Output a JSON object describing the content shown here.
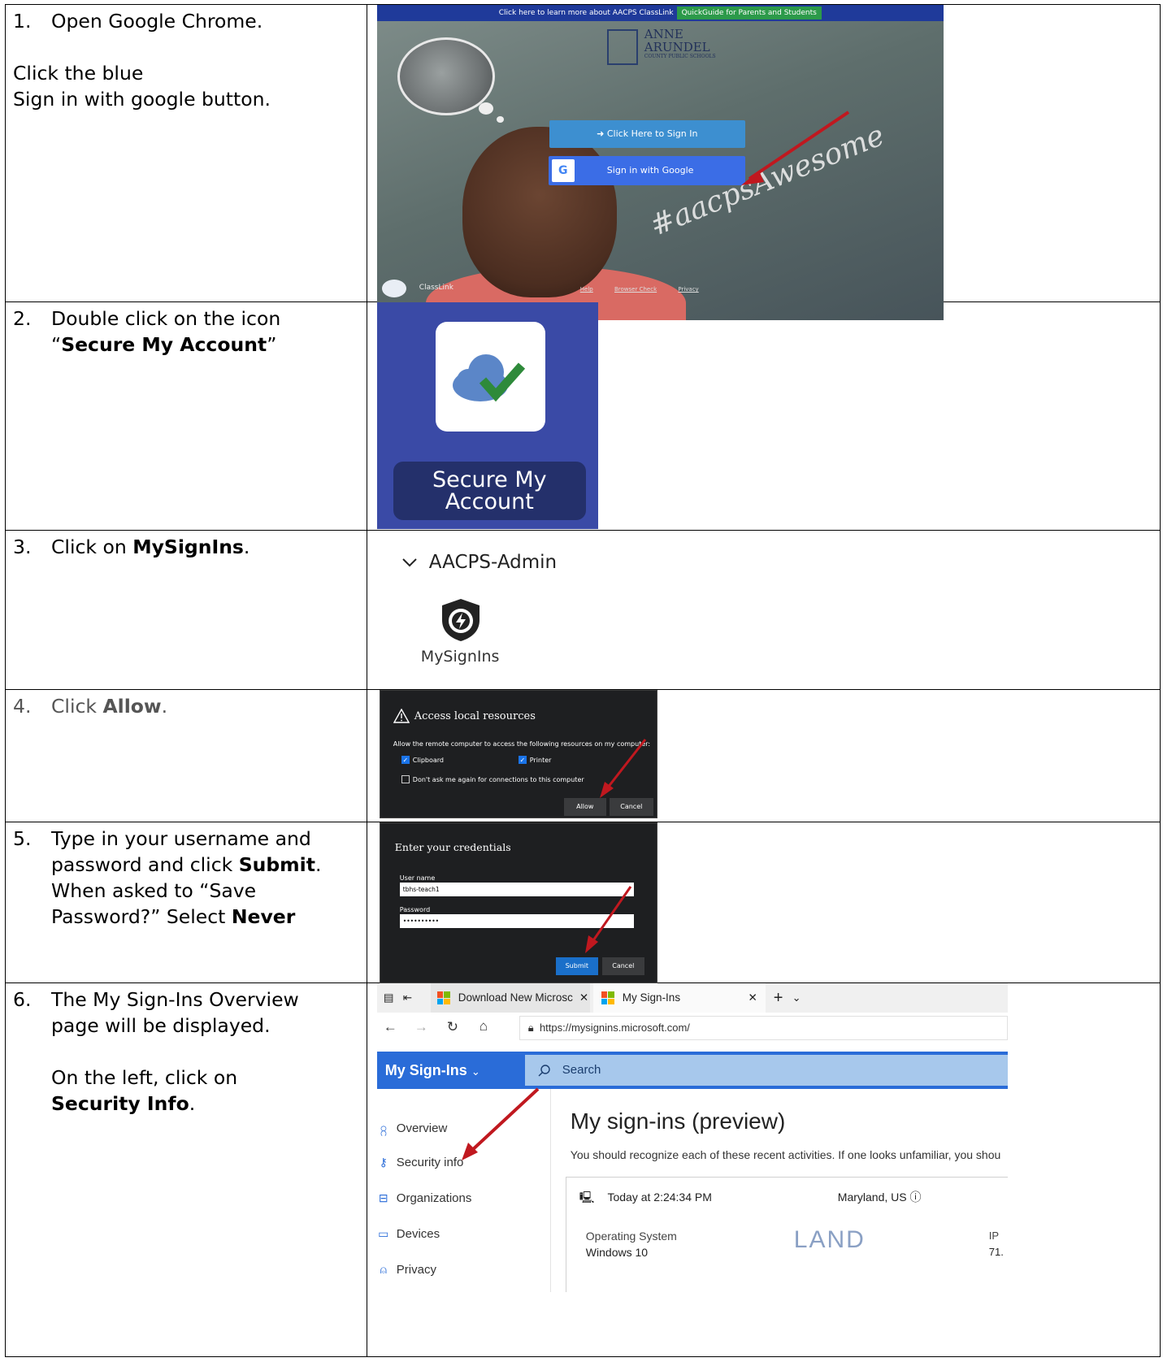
{
  "steps": {
    "s1": {
      "num": "1.",
      "line1": "Open Google Chrome.",
      "line2": "Click the blue",
      "line3": "Sign in with google button."
    },
    "s2": {
      "num": "2.",
      "line1": "Double click on the icon",
      "quote_open": "“",
      "bold": "Secure My Account",
      "quote_close": "”"
    },
    "s3": {
      "num": "3.",
      "pre": "Click on ",
      "bold": "MySignIns",
      "post": "."
    },
    "s4": {
      "num": "4.",
      "pre": "Click ",
      "bold": "Allow",
      "post": "."
    },
    "s5": {
      "num": "5.",
      "line1": "Type in your username and",
      "line2_pre": "password and click ",
      "line2_bold": "Submit",
      "line2_post": ".",
      "line3": "When asked to “Save",
      "line4_pre": "Password?” Select ",
      "line4_bold": "Never"
    },
    "s6": {
      "num": "6.",
      "line1": "The My Sign-Ins Overview",
      "line2": "page will be displayed.",
      "line3": "On the left, click on",
      "bold": "Security Info",
      "post": "."
    }
  },
  "shot1": {
    "banner_text": "Click here to learn more about AACPS ClassLink",
    "banner_button": "QuickGuide for Parents and Students",
    "logo_line1": "ANNE",
    "logo_line2": "ARUNDEL",
    "logo_line3": "COUNTY PUBLIC SCHOOLS",
    "signin_button": "Click Here to Sign In",
    "google_button": "Sign in with Google",
    "google_g": "G",
    "hashtag": "#aacpsAwesome",
    "classlink": "ClassLink",
    "footer_links": [
      "Help",
      "Browser Check",
      "Privacy"
    ]
  },
  "shot2": {
    "tile_label": "Secure My Account"
  },
  "shot3": {
    "group": "AACPS-Admin",
    "app": "MySignIns"
  },
  "shot4": {
    "title": "Access local resources",
    "description": "Allow the remote computer to access the following resources on my computer:",
    "checkbox_clipboard": "Clipboard",
    "checkbox_printer": "Printer",
    "checkbox_dont_ask": "Don't ask me again for connections to this computer",
    "allow_button": "Allow",
    "cancel_button": "Cancel"
  },
  "shot5": {
    "title": "Enter your credentials",
    "username_label": "User name",
    "username_value": "tbhs-teach1",
    "password_label": "Password",
    "password_value": "••••••••••",
    "submit_button": "Submit",
    "cancel_button": "Cancel"
  },
  "shot6": {
    "tab1": "Download New Microsc",
    "tab2": "My Sign-Ins",
    "url": "https://mysignins.microsoft.com/",
    "brand": "My Sign-Ins",
    "search": "Search",
    "nav": [
      "Overview",
      "Security info",
      "Organizations",
      "Devices",
      "Privacy"
    ],
    "heading": "My sign-ins (preview)",
    "subtitle": "You should recognize each of these recent activities. If one looks unfamiliar, you shou",
    "card_time": "Today at 2:24:34 PM",
    "card_location": "Maryland, US",
    "os_label": "Operating System",
    "os_value": "Windows 10",
    "map_text": "LAND",
    "ip_label": "IP",
    "ip_value": "71."
  },
  "colors": {
    "arrow": "#c0181f",
    "google_blue": "#3b6de6",
    "ms_blue": "#2a6cd8"
  }
}
